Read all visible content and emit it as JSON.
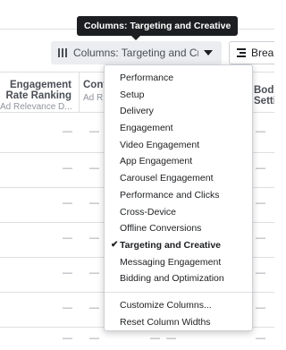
{
  "tooltip": {
    "text": "Columns: Targeting and Creative"
  },
  "toolbar": {
    "columns_label": "Columns: Targeting and Cre",
    "breakdown_label": "Brea"
  },
  "table": {
    "columns": [
      {
        "title": "Engagement Rate Ranking",
        "title_line1": "Engagement",
        "title_line2": "Rate Ranking",
        "subtitle": "Ad Relevance D..."
      },
      {
        "title": "Conv",
        "subtitle": "Ad R"
      },
      {
        "title_line1": "Body",
        "title_line2": "Setti"
      }
    ],
    "empty_cell": "—"
  },
  "menu": {
    "items": [
      {
        "label": "Performance",
        "selected": false
      },
      {
        "label": "Setup",
        "selected": false
      },
      {
        "label": "Delivery",
        "selected": false
      },
      {
        "label": "Engagement",
        "selected": false
      },
      {
        "label": "Video Engagement",
        "selected": false
      },
      {
        "label": "App Engagement",
        "selected": false
      },
      {
        "label": "Carousel Engagement",
        "selected": false
      },
      {
        "label": "Performance and Clicks",
        "selected": false
      },
      {
        "label": "Cross-Device",
        "selected": false
      },
      {
        "label": "Offline Conversions",
        "selected": false
      },
      {
        "label": "Targeting and Creative",
        "selected": true
      },
      {
        "label": "Messaging Engagement",
        "selected": false
      },
      {
        "label": "Bidding and Optimization",
        "selected": false
      }
    ],
    "actions": [
      {
        "label": "Customize Columns..."
      },
      {
        "label": "Reset Column Widths"
      }
    ],
    "check_glyph": "✔"
  }
}
